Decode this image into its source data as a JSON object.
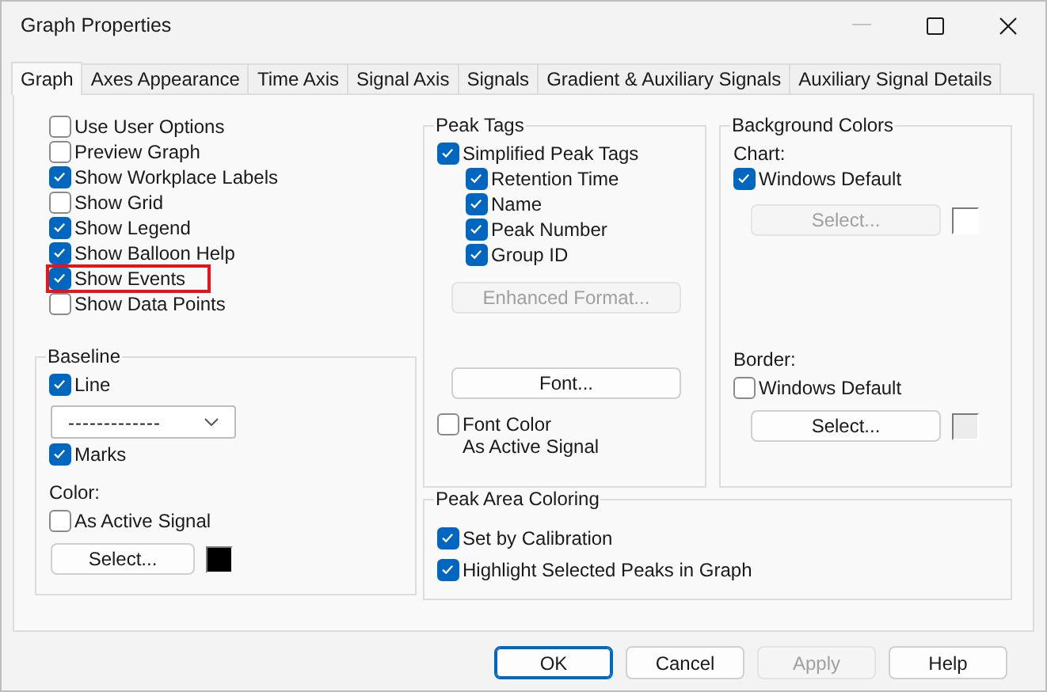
{
  "window": {
    "title": "Graph Properties"
  },
  "tabs": [
    {
      "label": "Graph",
      "selected": true
    },
    {
      "label": "Axes Appearance",
      "selected": false
    },
    {
      "label": "Time Axis",
      "selected": false
    },
    {
      "label": "Signal Axis",
      "selected": false
    },
    {
      "label": "Signals",
      "selected": false
    },
    {
      "label": "Gradient & Auxiliary Signals",
      "selected": false
    },
    {
      "label": "Auxiliary Signal Details",
      "selected": false
    }
  ],
  "options": [
    {
      "label": "Use User Options",
      "checked": false,
      "highlighted": false
    },
    {
      "label": "Preview Graph",
      "checked": false,
      "highlighted": false
    },
    {
      "label": "Show Workplace Labels",
      "checked": true,
      "highlighted": false
    },
    {
      "label": "Show Grid",
      "checked": false,
      "highlighted": false
    },
    {
      "label": "Show Legend",
      "checked": true,
      "highlighted": false
    },
    {
      "label": "Show Balloon Help",
      "checked": true,
      "highlighted": false
    },
    {
      "label": "Show Events",
      "checked": true,
      "highlighted": true
    },
    {
      "label": "Show Data Points",
      "checked": false,
      "highlighted": false
    }
  ],
  "baseline": {
    "title": "Baseline",
    "line": {
      "label": "Line",
      "checked": true
    },
    "line_style": "-------------",
    "marks": {
      "label": "Marks",
      "checked": true
    },
    "color_label": "Color:",
    "as_active_signal": {
      "label": "As Active Signal",
      "checked": false
    },
    "select_button": {
      "label": "Select...",
      "disabled": false
    }
  },
  "peak_tags": {
    "title": "Peak Tags",
    "simplified": {
      "label": "Simplified Peak Tags",
      "checked": true
    },
    "items": [
      {
        "label": "Retention Time",
        "checked": true
      },
      {
        "label": "Name",
        "checked": true
      },
      {
        "label": "Peak Number",
        "checked": true
      },
      {
        "label": "Group ID",
        "checked": true
      }
    ],
    "enhanced_button": {
      "label": "Enhanced Format...",
      "disabled": true
    },
    "font_button": {
      "label": "Font...",
      "disabled": false
    },
    "font_color": {
      "lines": [
        "Font Color",
        "As Active Signal"
      ],
      "checked": false
    }
  },
  "background_colors": {
    "title": "Background Colors",
    "chart_label": "Chart:",
    "chart_default": {
      "label": "Windows Default",
      "checked": true
    },
    "chart_select": {
      "label": "Select...",
      "disabled": true
    },
    "border_label": "Border:",
    "border_default": {
      "label": "Windows Default",
      "checked": false
    },
    "border_select": {
      "label": "Select...",
      "disabled": false
    }
  },
  "peak_area_coloring": {
    "title": "Peak Area Coloring",
    "items": [
      {
        "label": "Set by Calibration",
        "checked": true
      },
      {
        "label": "Highlight Selected Peaks in Graph",
        "checked": true
      }
    ]
  },
  "buttons": [
    {
      "label": "OK",
      "disabled": false,
      "default": true
    },
    {
      "label": "Cancel",
      "disabled": false,
      "default": false
    },
    {
      "label": "Apply",
      "disabled": true,
      "default": false
    },
    {
      "label": "Help",
      "disabled": false,
      "default": false
    }
  ]
}
